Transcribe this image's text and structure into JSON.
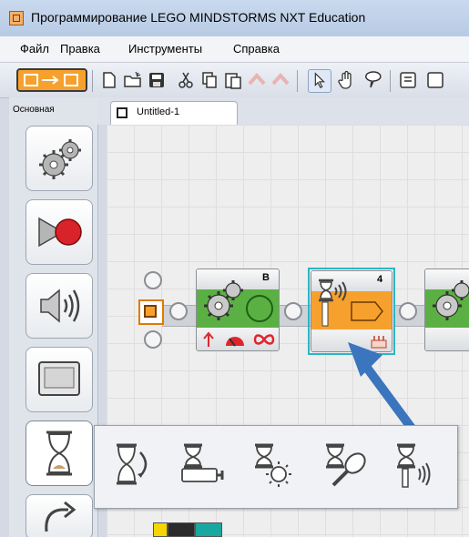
{
  "window": {
    "title": "Программирование LEGO MINDSTORMS NXT Education"
  },
  "menu": {
    "items": [
      "Файл",
      "Правка",
      "Инструменты",
      "Справка"
    ]
  },
  "toolbar": {
    "icons": [
      "nxt-switch-icon",
      "new-file-icon",
      "open-file-icon",
      "save-icon",
      "cut-icon",
      "copy-icon",
      "paste-icon",
      "undo-icon",
      "redo-icon",
      "pointer-icon",
      "pan-hand-icon",
      "comment-icon",
      "list-icon"
    ]
  },
  "palette": {
    "tab_label": "Основная",
    "buttons": [
      "move-gear-icon",
      "record-play-icon",
      "sound-speaker-icon",
      "display-screen-icon",
      "wait-hourglass-icon",
      "loop-icon"
    ]
  },
  "document": {
    "tab_label": "Untitled-1"
  },
  "program": {
    "move_block": {
      "port": "B"
    },
    "sound_block": {
      "port": "4"
    }
  },
  "popup": {
    "icons": [
      "wait-timer-icon",
      "wait-touch-sensor-icon",
      "wait-light-sensor-icon",
      "wait-sound-sensor-icon",
      "wait-ultrasonic-sensor-icon"
    ]
  },
  "colors": {
    "accent_orange": "#f6a12d",
    "block_green": "#5bb043",
    "arrow_blue": "#3a75bd",
    "selection_cyan": "#2bb6c4"
  }
}
